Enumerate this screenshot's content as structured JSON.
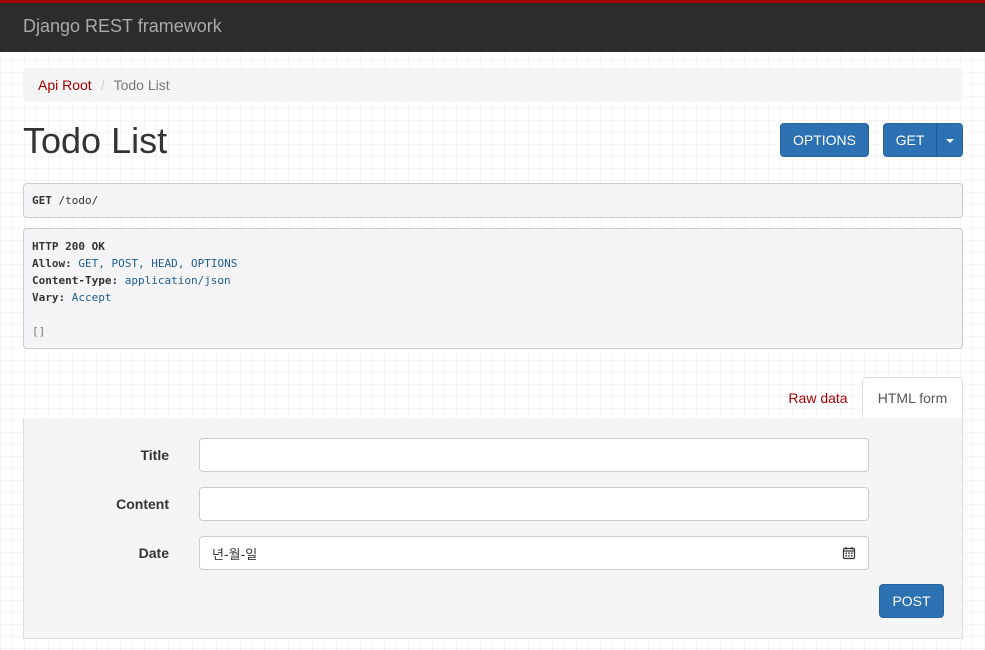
{
  "navbar": {
    "brand": "Django REST framework"
  },
  "breadcrumb": {
    "root": "Api Root",
    "separator": "/",
    "current": "Todo List"
  },
  "page": {
    "title": "Todo List"
  },
  "buttons": {
    "options": "OPTIONS",
    "get": "GET",
    "post": "POST"
  },
  "request": {
    "method": "GET",
    "path": "/todo/"
  },
  "response": {
    "status": "HTTP 200 OK",
    "allow_key": "Allow:",
    "allow_val": "GET, POST, HEAD, OPTIONS",
    "ctype_key": "Content-Type:",
    "ctype_val": "application/json",
    "vary_key": "Vary:",
    "vary_val": "Accept",
    "body": "[]"
  },
  "tabs": {
    "raw": "Raw data",
    "html": "HTML form"
  },
  "form": {
    "title_label": "Title",
    "content_label": "Content",
    "date_label": "Date",
    "date_placeholder": "년-월-일"
  },
  "colors": {
    "brand_red": "#a30000",
    "button_blue": "#2c72b3",
    "navbar_bg": "#2c2c2c"
  },
  "icons": {
    "date_picker": "calendar-icon",
    "dropdown": "caret-down-icon"
  }
}
